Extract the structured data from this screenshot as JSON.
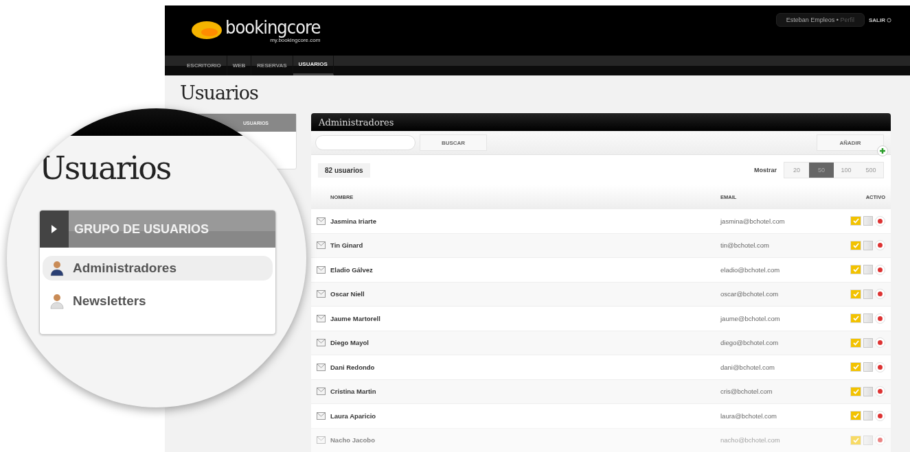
{
  "header": {
    "logo": {
      "name": "bookingcore",
      "subtitle": "my.bookingcore.com"
    },
    "user": {
      "name": "Esteban Empleos",
      "separator": "•",
      "link": "Perfil"
    },
    "logout": "SALIR"
  },
  "nav": [
    {
      "label": "ESCRITORIO",
      "selected": false
    },
    {
      "label": "WEB",
      "selected": false
    },
    {
      "label": "RESERVAS",
      "selected": false
    },
    {
      "label": "USUARIOS",
      "selected": true
    }
  ],
  "page_title": "Usuarios",
  "sidebar": {
    "header": "USUARIOS"
  },
  "magnifier": {
    "title": "Usuarios",
    "group_header": "GRUPO DE USUARIOS",
    "items": [
      {
        "label": "Administradores",
        "selected": true
      },
      {
        "label": "Newsletters",
        "selected": false
      }
    ]
  },
  "panel": {
    "title": "Administradores",
    "search_button": "BUSCAR",
    "add_button": "AÑADIR",
    "count": "82 usuarios",
    "show_label": "Mostrar",
    "page_sizes": [
      {
        "label": "20",
        "selected": false
      },
      {
        "label": "50",
        "selected": true
      },
      {
        "label": "100",
        "selected": false
      },
      {
        "label": "500",
        "selected": false
      }
    ],
    "columns": [
      "NOMBRE",
      "EMAIL",
      "ACTIVO"
    ],
    "rows": [
      {
        "name": "Jasmina Iriarte",
        "email": "jasmina@bchotel.com",
        "checked": true,
        "faded": false
      },
      {
        "name": "Tin Ginard",
        "email": "tin@bchotel.com",
        "checked": true,
        "faded": false
      },
      {
        "name": "Eladio Gálvez",
        "email": "eladio@bchotel.com",
        "checked": true,
        "faded": false
      },
      {
        "name": "Oscar Niell",
        "email": "oscar@bchotel.com",
        "checked": true,
        "faded": false
      },
      {
        "name": "Jaume Martorell",
        "email": "jaume@bchotel.com",
        "checked": true,
        "faded": false
      },
      {
        "name": "Diego Mayol",
        "email": "diego@bchotel.com",
        "checked": true,
        "faded": false
      },
      {
        "name": "Dani Redondo",
        "email": "dani@bchotel.com",
        "checked": true,
        "faded": false
      },
      {
        "name": "Cristina Martin",
        "email": "cris@bchotel.com",
        "checked": true,
        "faded": false
      },
      {
        "name": "Laura Aparicio",
        "email": "laura@bchotel.com",
        "checked": true,
        "faded": false
      },
      {
        "name": "Nacho Jacobo",
        "email": "nacho@bchotel.com",
        "checked": true,
        "faded": true
      }
    ]
  }
}
